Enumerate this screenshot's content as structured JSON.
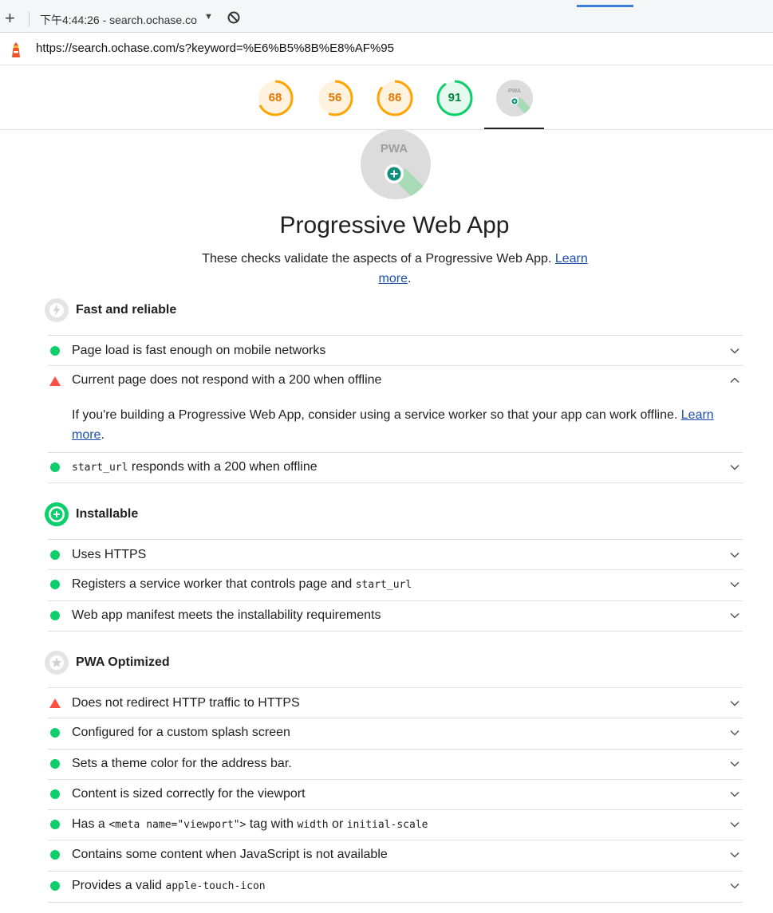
{
  "browser": {
    "tab_title": "下午4:44:26 - search.ochase.co",
    "url": "https://search.ochase.com/s?keyword=%E6%B5%8B%E8%AF%95"
  },
  "gauges": [
    {
      "score": "68",
      "color": "#ffa400"
    },
    {
      "score": "56",
      "color": "#ffa400"
    },
    {
      "score": "86",
      "color": "#ffa400"
    },
    {
      "score": "91",
      "color": "#0cce6b"
    },
    {
      "label": "PWA"
    }
  ],
  "header": {
    "badge_label": "PWA",
    "title": "Progressive Web App",
    "description": "These checks validate the aspects of a Progressive Web App.",
    "learn": "Learn",
    "more": "more"
  },
  "groups": {
    "fast": {
      "title": "Fast and reliable",
      "audits": [
        {
          "status": "pass",
          "text": "Page load is fast enough on mobile networks"
        },
        {
          "status": "fail",
          "text": "Current page does not respond with a 200 when offline",
          "expanded": true,
          "detail": "If you're building a Progressive Web App, consider using a service worker so that your app can work offline.",
          "detail_link_a": "Learn",
          "detail_link_b": "more"
        },
        {
          "status": "pass",
          "code": "start_url",
          "text": " responds with a 200 when offline"
        }
      ]
    },
    "installable": {
      "title": "Installable",
      "audits": [
        {
          "status": "pass",
          "text": "Uses HTTPS"
        },
        {
          "status": "pass",
          "text": "Registers a service worker that controls page and ",
          "code": "start_url"
        },
        {
          "status": "pass",
          "text": "Web app manifest meets the installability requirements"
        }
      ]
    },
    "optimized": {
      "title": "PWA Optimized",
      "audits": [
        {
          "status": "fail",
          "text": "Does not redirect HTTP traffic to HTTPS"
        },
        {
          "status": "pass",
          "text": "Configured for a custom splash screen"
        },
        {
          "status": "pass",
          "text": "Sets a theme color for the address bar."
        },
        {
          "status": "pass",
          "text": "Content is sized correctly for the viewport"
        },
        {
          "status": "pass",
          "pre": "Has a ",
          "code1": "<meta name=\"viewport\">",
          "mid": " tag with ",
          "code2": "width",
          "or": " or ",
          "code3": "initial-scale"
        },
        {
          "status": "pass",
          "text": "Contains some content when JavaScript is not available"
        },
        {
          "status": "pass",
          "text": "Provides a valid ",
          "code": "apple-touch-icon"
        }
      ]
    }
  }
}
